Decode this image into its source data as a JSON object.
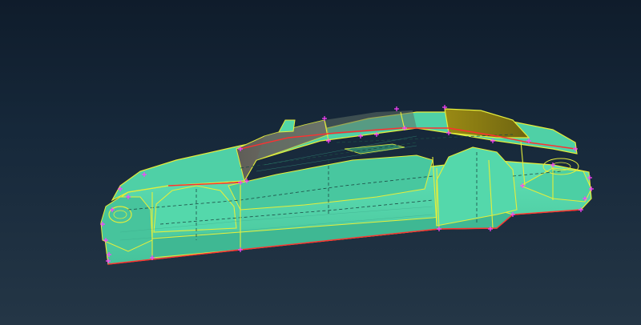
{
  "viewport": {
    "background_top": "#0f1c2b",
    "background_bottom": "#243646"
  },
  "model": {
    "surface_color": "#52d6a8",
    "surface_dark": "#2f8f78",
    "roof_color": "#6e6c63",
    "rear_glass_color": "#8a7a16",
    "edge_color": "#e6ee3a",
    "boundary_color": "#ff3030",
    "isoparm_color": "#1b4a44",
    "vertex_marker_color": "#ff40ff"
  },
  "icons": {
    "vertex_marker": "plus-marker-icon"
  }
}
